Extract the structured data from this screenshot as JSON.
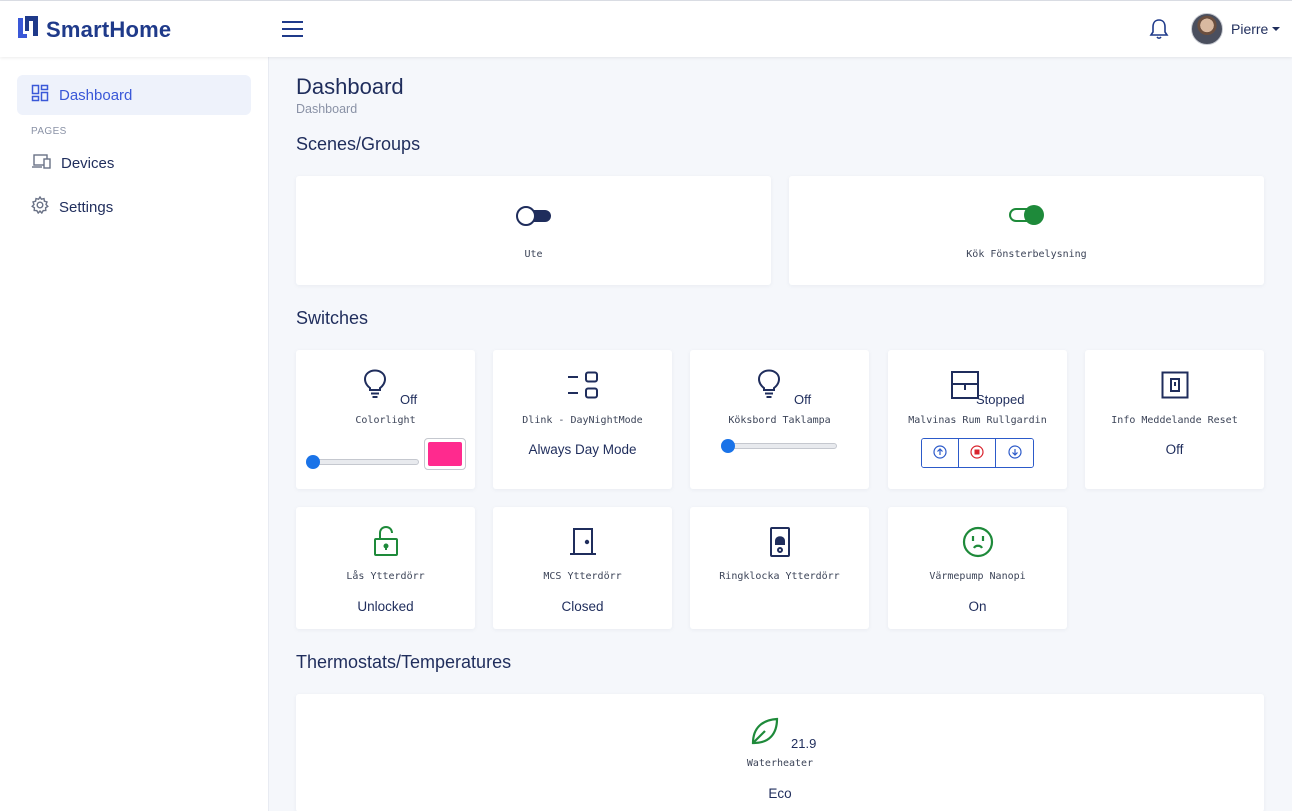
{
  "app": {
    "title": "SmartHome"
  },
  "header": {
    "user_name": "Pierre"
  },
  "sidebar": {
    "items": [
      {
        "label": "Dashboard"
      },
      {
        "label": "Devices"
      },
      {
        "label": "Settings"
      }
    ],
    "section_heading": "PAGES"
  },
  "page": {
    "title": "Dashboard",
    "breadcrumb": "Dashboard"
  },
  "sections": {
    "scenes": "Scenes/Groups",
    "switches": "Switches",
    "thermostats": "Thermostats/Temperatures"
  },
  "scenes": [
    {
      "name": "Ute",
      "state": "off",
      "icon": "toggle-off-icon"
    },
    {
      "name": "Kök Fönsterbelysning",
      "state": "on",
      "icon": "toggle-on-icon"
    }
  ],
  "switches": [
    {
      "name": "Colorlight",
      "state": "Off",
      "icon": "lightbulb-icon",
      "dim_level": 0,
      "color": "#ff2a8e"
    },
    {
      "name": "Dlink - DayNightMode",
      "value": "Always Day Mode",
      "icon": "selector-icon"
    },
    {
      "name": "Köksbord Taklampa",
      "state": "Off",
      "icon": "lightbulb-icon",
      "dim_level": 0
    },
    {
      "name": "Malvinas Rum Rullgardin",
      "state": "Stopped",
      "icon": "blinds-icon"
    },
    {
      "name": "Info Meddelande Reset",
      "value": "Off",
      "icon": "push-button-icon"
    },
    {
      "name": "Lås Ytterdörr",
      "value": "Unlocked",
      "icon": "lock-open-icon"
    },
    {
      "name": "MCS Ytterdörr",
      "value": "Closed",
      "icon": "door-icon"
    },
    {
      "name": "Ringklocka Ytterdörr",
      "value": "",
      "icon": "doorbell-icon"
    },
    {
      "name": "Värmepump Nanopi",
      "value": "On",
      "icon": "outlet-icon"
    }
  ],
  "thermostats": [
    {
      "name": "Waterheater",
      "temperature": "21.9",
      "value": "Eco",
      "icon": "leaf-icon"
    }
  ],
  "colors": {
    "accent": "#3a58d8",
    "navy": "#1f2d5c",
    "green": "#1e8a3a",
    "pink": "#ff2a8e"
  }
}
